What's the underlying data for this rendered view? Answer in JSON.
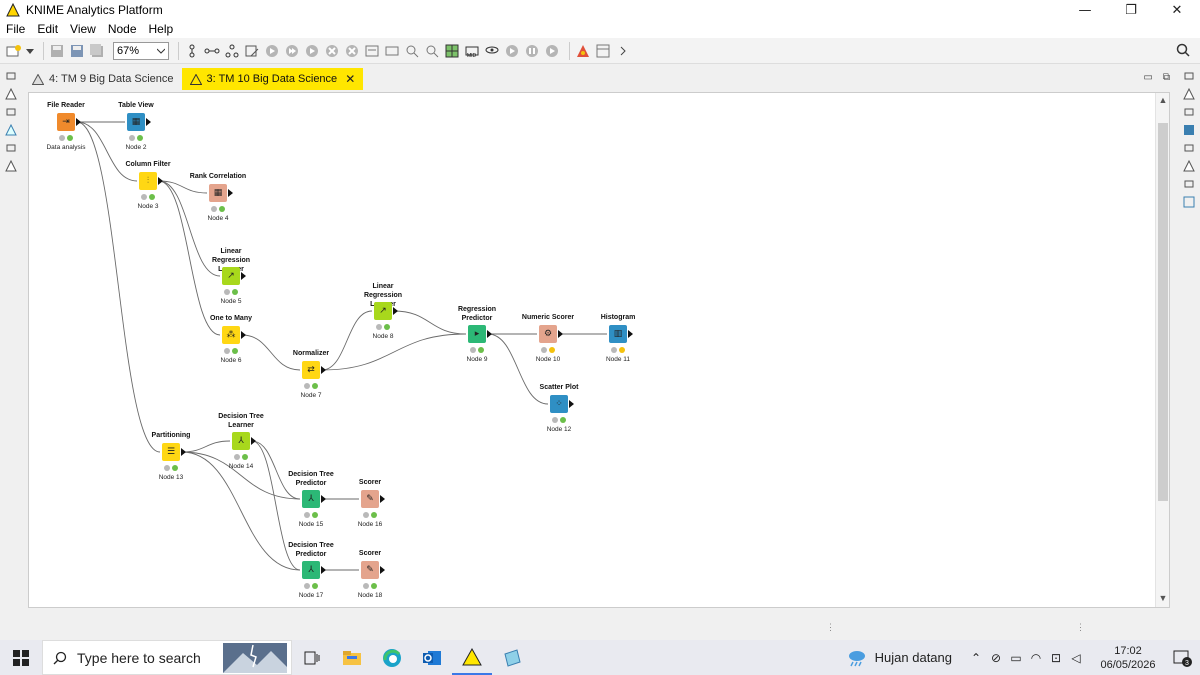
{
  "window": {
    "title": "KNIME Analytics Platform",
    "minimize": "—",
    "maximize": "❐",
    "close": "✕"
  },
  "menu": [
    "File",
    "Edit",
    "View",
    "Node",
    "Help"
  ],
  "toolbar": {
    "zoom_value": "67%",
    "icons": [
      "new-workflow-icon",
      "save-icon",
      "save-as-icon",
      "save-all-icon",
      "align-icon",
      "horizontal-layout-icon",
      "vertical-layout-icon",
      "configure-icon",
      "execute-icon",
      "execute-all-icon",
      "execute-open-view-icon",
      "cancel-icon",
      "cancel-all-icon",
      "reset-icon",
      "edit-name-icon",
      "node-description-icon",
      "zoom-icon",
      "grid-icon",
      "annotation-icon",
      "hide-node-names-icon",
      "open-view-icon",
      "step-loop-icon",
      "pause-loop-icon",
      "resume-loop-icon",
      "debug-icon",
      "layout-editor-icon",
      "more-icon"
    ]
  },
  "tabs": [
    {
      "label": "4: TM 9 Big Data Science",
      "active": false
    },
    {
      "label": "3: TM 10 Big Data Science",
      "active": true
    }
  ],
  "nodes": [
    {
      "id": "file-reader",
      "title": "File Reader",
      "label": "Data analysis",
      "color": "#f08a2c",
      "glyph": "⇥",
      "leds": [
        "grey",
        "green"
      ]
    },
    {
      "id": "table-view",
      "title": "Table View",
      "label": "Node 2",
      "color": "#2f8fc4",
      "glyph": "▦",
      "leds": [
        "grey",
        "green"
      ]
    },
    {
      "id": "column-filter",
      "title": "Column Filter",
      "label": "Node 3",
      "color": "#ffd714",
      "glyph": "⫶",
      "leds": [
        "grey",
        "green"
      ]
    },
    {
      "id": "rank-correlation",
      "title": "Rank Correlation",
      "label": "Node 4",
      "color": "#e4a48d",
      "glyph": "▦",
      "leds": [
        "grey",
        "green"
      ]
    },
    {
      "id": "lin-reg-learner-5",
      "title": "Linear Regression Learner",
      "label": "Node 5",
      "color": "#a8d81c",
      "glyph": "↗",
      "leds": [
        "grey",
        "green"
      ]
    },
    {
      "id": "one-to-many",
      "title": "One to Many",
      "label": "Node 6",
      "color": "#ffd714",
      "glyph": "⁂",
      "leds": [
        "grey",
        "green"
      ]
    },
    {
      "id": "normalizer",
      "title": "Normalizer",
      "label": "Node 7",
      "color": "#ffd714",
      "glyph": "⇄",
      "leds": [
        "grey",
        "green"
      ]
    },
    {
      "id": "lin-reg-learner-8",
      "title": "Linear Regression Learner",
      "label": "Node 8",
      "color": "#a8d81c",
      "glyph": "↗",
      "leds": [
        "grey",
        "green"
      ]
    },
    {
      "id": "regression-predictor",
      "title": "Regression Predictor",
      "label": "Node 9",
      "color": "#2cb876",
      "glyph": "▸",
      "leds": [
        "grey",
        "green"
      ]
    },
    {
      "id": "numeric-scorer",
      "title": "Numeric Scorer",
      "label": "Node 10",
      "color": "#e4a48d",
      "glyph": "⚙",
      "leds": [
        "grey",
        "yellow"
      ]
    },
    {
      "id": "histogram",
      "title": "Histogram",
      "label": "Node 11",
      "color": "#2f8fc4",
      "glyph": "▥",
      "leds": [
        "grey",
        "yellow"
      ]
    },
    {
      "id": "scatter-plot",
      "title": "Scatter Plot",
      "label": "Node 12",
      "color": "#2f8fc4",
      "glyph": "⁘",
      "leds": [
        "grey",
        "green"
      ]
    },
    {
      "id": "partitioning",
      "title": "Partitioning",
      "label": "Node 13",
      "color": "#ffd714",
      "glyph": "☰",
      "leds": [
        "grey",
        "green"
      ]
    },
    {
      "id": "dt-learner",
      "title": "Decision Tree Learner",
      "label": "Node 14",
      "color": "#a8d81c",
      "glyph": "⅄",
      "leds": [
        "grey",
        "green"
      ]
    },
    {
      "id": "dt-predictor-15",
      "title": "Decision Tree Predictor",
      "label": "Node 15",
      "color": "#2cb876",
      "glyph": "⅄",
      "leds": [
        "grey",
        "green"
      ]
    },
    {
      "id": "scorer-16",
      "title": "Scorer",
      "label": "Node 16",
      "color": "#e4a48d",
      "glyph": "✎",
      "leds": [
        "grey",
        "green"
      ]
    },
    {
      "id": "dt-predictor-17",
      "title": "Decision Tree Predictor",
      "label": "Node 17",
      "color": "#2cb876",
      "glyph": "⅄",
      "leds": [
        "grey",
        "green"
      ]
    },
    {
      "id": "scorer-18",
      "title": "Scorer",
      "label": "Node 18",
      "color": "#e4a48d",
      "glyph": "✎",
      "leds": [
        "grey",
        "green"
      ]
    }
  ],
  "taskbar": {
    "search_placeholder": "Type here to search",
    "weather": "Hujan datang",
    "time": "17:02",
    "date": "06/05/2026",
    "notification_count": "3"
  }
}
